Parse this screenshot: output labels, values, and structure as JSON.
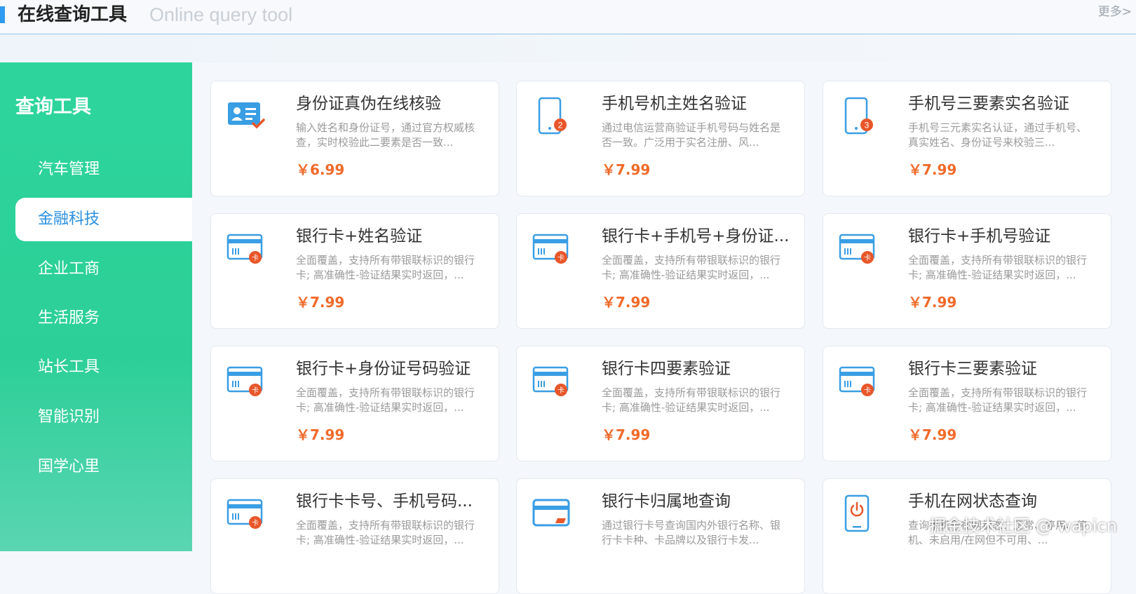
{
  "header": {
    "title": "在线查询工具",
    "subtitle": "Online query tool",
    "more_label": "更多>"
  },
  "sidebar": {
    "title": "查询工具",
    "items": [
      {
        "label": "汽车管理",
        "active": false
      },
      {
        "label": "金融科技",
        "active": true
      },
      {
        "label": "企业工商",
        "active": false
      },
      {
        "label": "生活服务",
        "active": false
      },
      {
        "label": "站长工具",
        "active": false
      },
      {
        "label": "智能识别",
        "active": false
      },
      {
        "label": "国学心里",
        "active": false
      }
    ]
  },
  "cards": [
    {
      "title": "身份证真伪在线核验",
      "desc": "输入姓名和身份证号，通过官方权威核查，实时校验此二要素是否一致...",
      "price": "￥6.99",
      "icon": "id-card-icon"
    },
    {
      "title": "手机号机主姓名验证",
      "desc": "通过电信运营商验证手机号码与姓名是否一致。广泛用于实名注册、风...",
      "price": "￥7.99",
      "icon": "phone-2-icon"
    },
    {
      "title": "手机号三要素实名验证",
      "desc": "手机号三元素实名认证，通过手机号、真实姓名、身份证号来校验三...",
      "price": "￥7.99",
      "icon": "phone-3-icon"
    },
    {
      "title": "银行卡+姓名验证",
      "desc": "全面覆盖，支持所有带银联标识的银行卡; 高准确性-验证结果实时返回，...",
      "price": "￥7.99",
      "icon": "bank-card-icon"
    },
    {
      "title": "银行卡+手机号+身份证...",
      "desc": "全面覆盖，支持所有带银联标识的银行卡; 高准确性-验证结果实时返回，...",
      "price": "￥7.99",
      "icon": "bank-card-icon"
    },
    {
      "title": "银行卡+手机号验证",
      "desc": "全面覆盖，支持所有带银联标识的银行卡; 高准确性-验证结果实时返回，...",
      "price": "￥7.99",
      "icon": "bank-card-icon"
    },
    {
      "title": "银行卡+身份证号码验证",
      "desc": "全面覆盖，支持所有带银联标识的银行卡; 高准确性-验证结果实时返回，...",
      "price": "￥7.99",
      "icon": "bank-card-icon"
    },
    {
      "title": "银行卡四要素验证",
      "desc": "全面覆盖，支持所有带银联标识的银行卡; 高准确性-验证结果实时返回，...",
      "price": "￥7.99",
      "icon": "bank-card-icon"
    },
    {
      "title": "银行卡三要素验证",
      "desc": "全面覆盖，支持所有带银联标识的银行卡; 高准确性-验证结果实时返回，...",
      "price": "￥7.99",
      "icon": "bank-card-icon"
    },
    {
      "title": "银行卡卡号、手机号码...",
      "desc": "全面覆盖，支持所有带银联标识的银行卡; 高准确性-验证结果实时返回，...",
      "price": "",
      "icon": "bank-card-icon"
    },
    {
      "title": "银行卡归属地查询",
      "desc": "通过银行卡号查询国内外银行名称、银行卡卡种、卡品牌以及银行卡发...",
      "price": "",
      "icon": "card-location-icon"
    },
    {
      "title": "手机在网状态查询",
      "desc": "查询手机号在网状态：正常、停用、停机、未启用/在网但不可用、...",
      "price": "",
      "icon": "phone-power-icon"
    }
  ],
  "watermark": "掘金技术社区 @ wapicn",
  "colors": {
    "accent": "#2d9bf0",
    "sidebar": "#2dd59c",
    "price": "#f06a2a",
    "icon_blue": "#3a9ee4",
    "badge": "#e8562a"
  }
}
